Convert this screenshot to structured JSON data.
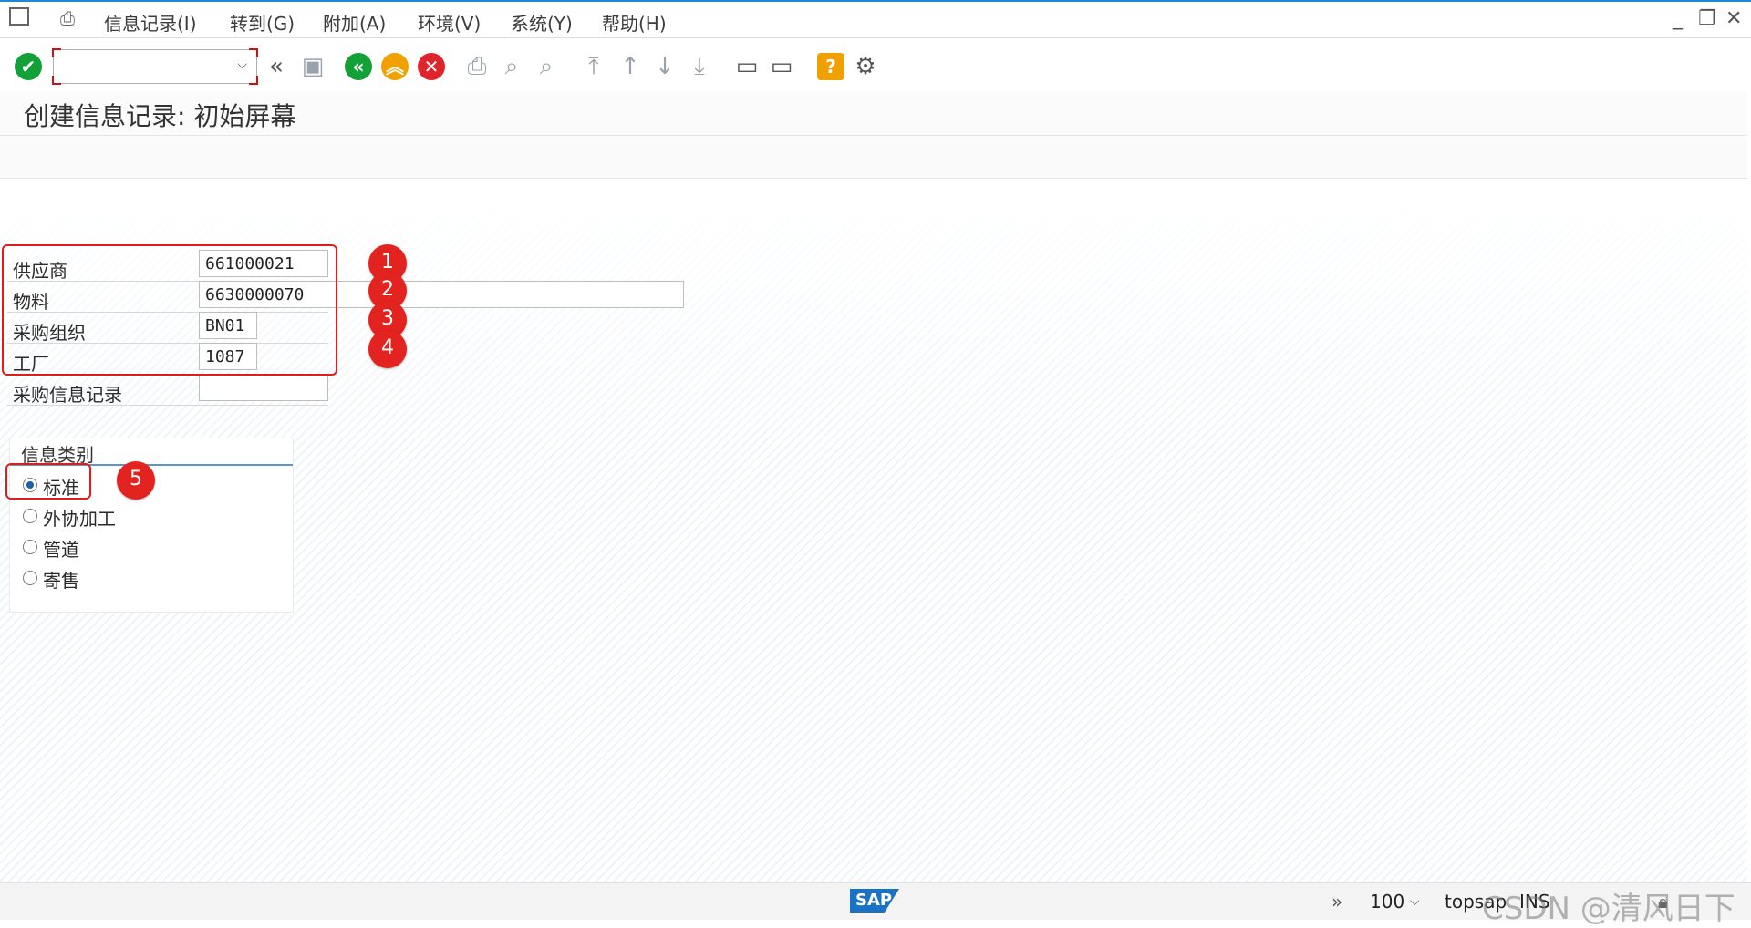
{
  "menu": {
    "items": [
      {
        "label": "信息记录(I)"
      },
      {
        "label": "转到(G)"
      },
      {
        "label": "附加(A)"
      },
      {
        "label": "环境(V)"
      },
      {
        "label": "系统(Y)"
      },
      {
        "label": "帮助(H)"
      }
    ]
  },
  "window_controls": {
    "minimize": "_",
    "restore": "❐",
    "close": "✕"
  },
  "toolbar": {
    "command_value": ""
  },
  "page": {
    "title": "创建信息记录: 初始屏幕"
  },
  "form": {
    "fields": [
      {
        "label": "供应商",
        "value": "661000021"
      },
      {
        "label": "物料",
        "value": "6630000070"
      },
      {
        "label": "采购组织",
        "value": "BN01"
      },
      {
        "label": "工厂",
        "value": "1087"
      },
      {
        "label": "采购信息记录",
        "value": ""
      }
    ]
  },
  "info_category": {
    "title": "信息类别",
    "options": [
      {
        "label": "标准",
        "selected": true
      },
      {
        "label": "外协加工",
        "selected": false
      },
      {
        "label": "管道",
        "selected": false
      },
      {
        "label": "寄售",
        "selected": false
      }
    ]
  },
  "annotations": [
    "1",
    "2",
    "3",
    "4",
    "5"
  ],
  "status": {
    "zoom": "100",
    "system": "topsap",
    "mode": "INS",
    "logo": "SAP",
    "watermark": "CSDN @清风日下"
  },
  "colors": {
    "accent": "#e3231f",
    "ok_green": "#12a037",
    "nav_orange": "#f0a000",
    "cancel_red": "#e0242b"
  }
}
